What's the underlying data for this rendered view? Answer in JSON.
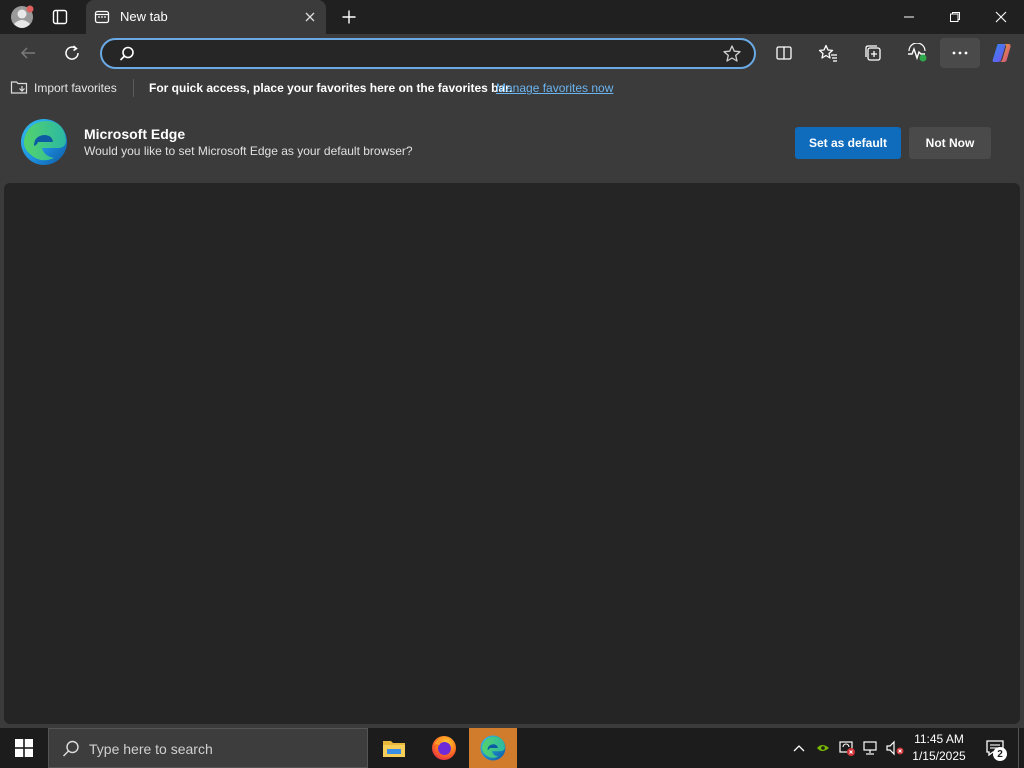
{
  "window": {
    "tab_title": "New tab",
    "tab_favicon": "new-tab-page-icon",
    "controls": [
      "minimize-icon",
      "restore-icon",
      "close-icon"
    ]
  },
  "toolbar": {
    "address_value": "",
    "icons": [
      "back-arrow-icon",
      "refresh-icon",
      "search-icon",
      "star-icon",
      "split-screen-icon",
      "favorites-icon",
      "collections-icon",
      "performance-icon",
      "more-icon",
      "copilot-icon"
    ]
  },
  "favorites_bar": {
    "import_label": "Import favorites",
    "message": "For quick access, place your favorites here on the favorites bar.",
    "manage_link": "Manage favorites now"
  },
  "infobar": {
    "title": "Microsoft Edge",
    "subtitle": "Would you like to set Microsoft Edge as your default browser?",
    "primary_button": "Set as default",
    "secondary_button": "Not Now"
  },
  "taskbar": {
    "search_placeholder": "Type here to search",
    "apps": [
      "file-explorer-icon",
      "firefox-icon",
      "edge-icon"
    ],
    "active_app": "edge-icon",
    "time": "11:45 AM",
    "date": "1/15/2025",
    "notification_count": "2"
  },
  "colors": {
    "accent": "#0f6cbd",
    "link": "#6cb4f0",
    "omnibox_focus": "#6aa9e4",
    "active_taskbar_app": "#d07c2c"
  }
}
